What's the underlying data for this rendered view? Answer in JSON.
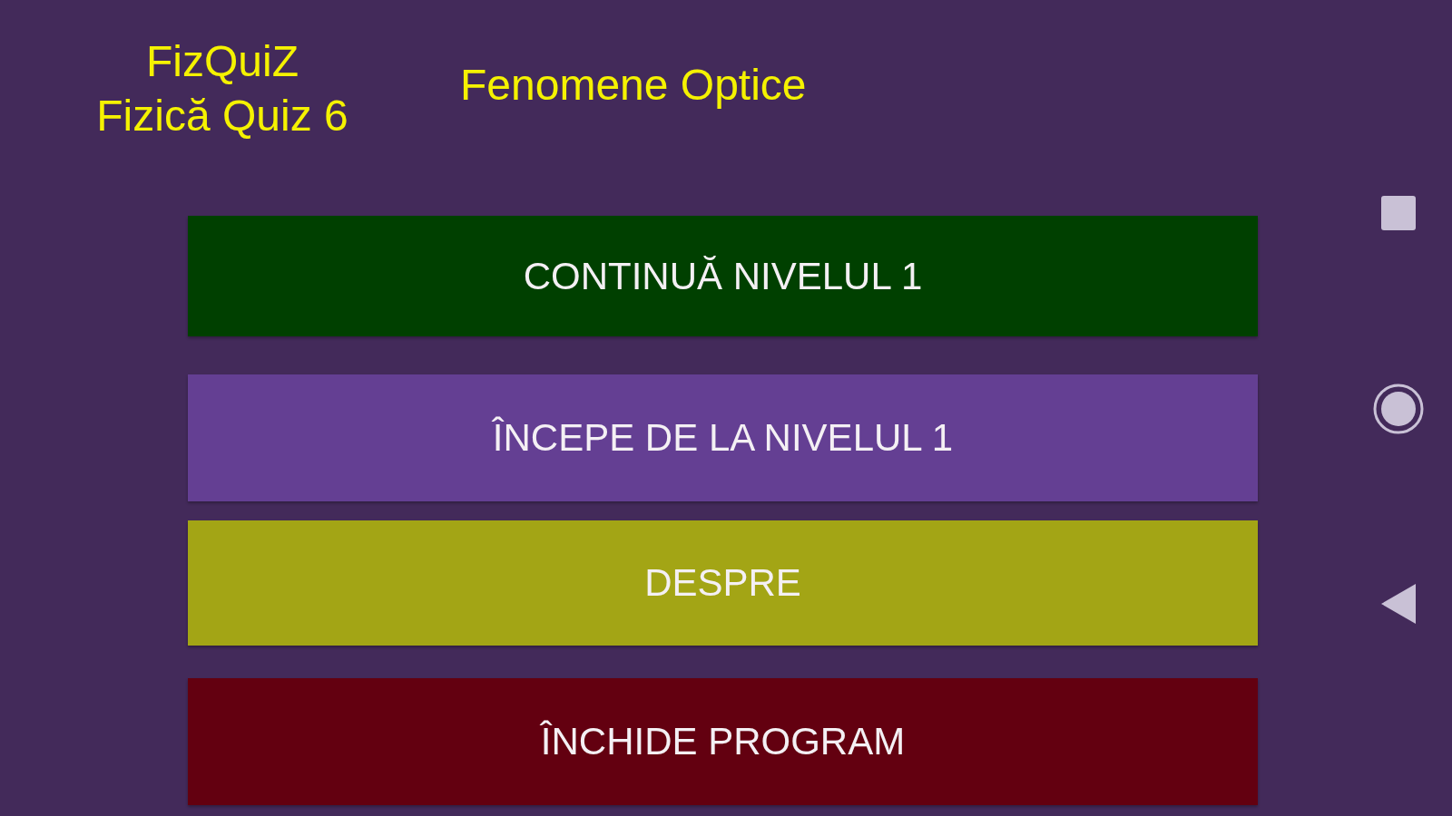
{
  "app_title": {
    "line_1": "FizQuiZ",
    "line_2": "Fizică Quiz 6"
  },
  "topic": "Fenomene Optice",
  "menu_buttons": [
    {
      "label": "CONTINUĂ NIVELUL 1",
      "color": "#004000"
    },
    {
      "label": "ÎNCEPE DE LA NIVELUL 1",
      "color": "#643f93"
    },
    {
      "label": "DESPRE",
      "color": "#a3a515"
    },
    {
      "label": "ÎNCHIDE PROGRAM",
      "color": "#630010"
    }
  ]
}
